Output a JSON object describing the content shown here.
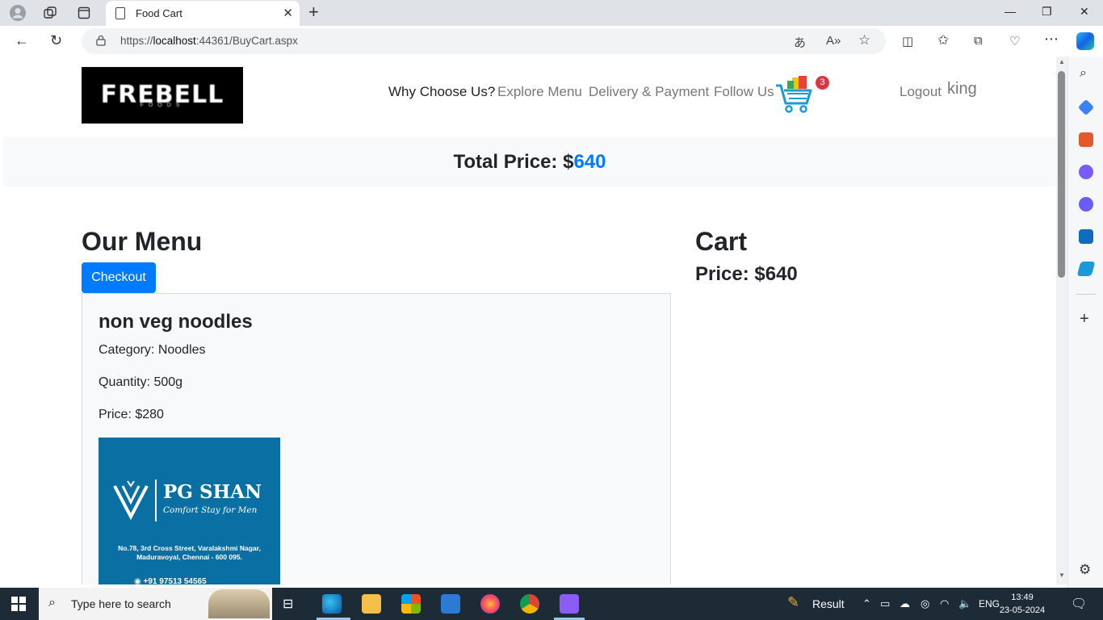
{
  "browser": {
    "tab_title": "Food Cart",
    "url_prefix": "https://",
    "url_host": "localhost",
    "url_rest": ":44361/BuyCart.aspx",
    "accent": "#1a73e8"
  },
  "header": {
    "logo_text": "FREBELL",
    "logo_sub": "FOODS",
    "nav": [
      "Why Choose Us?",
      "Explore Menu",
      "Delivery & Payment",
      "Follow Us"
    ],
    "cart_count": "3",
    "logout": "Logout",
    "username": "king"
  },
  "total": {
    "label": "Total Price: $",
    "value": "640",
    "accent": "#007bff"
  },
  "menu": {
    "title": "Our Menu",
    "checkout": "Checkout",
    "item": {
      "name": "non veg noodles",
      "category": "Category: Noodles",
      "quantity": "Quantity: 500g",
      "price": "Price: $280",
      "image": {
        "brand": "PG SHAN",
        "tagline": "Comfort Stay for Men",
        "address_1": "No.78, 3rd Cross Street, Varalakshmi Nagar,",
        "address_2": "Maduravoyal, Chennai - 600 095.",
        "phone": "+91 97513 54565"
      }
    }
  },
  "cart": {
    "title": "Cart",
    "price": "Price: $640"
  },
  "taskbar": {
    "search_placeholder": "Type here to search",
    "result_label": "Result",
    "language": "ENG",
    "time": "13:49",
    "date": "23-05-2024"
  }
}
